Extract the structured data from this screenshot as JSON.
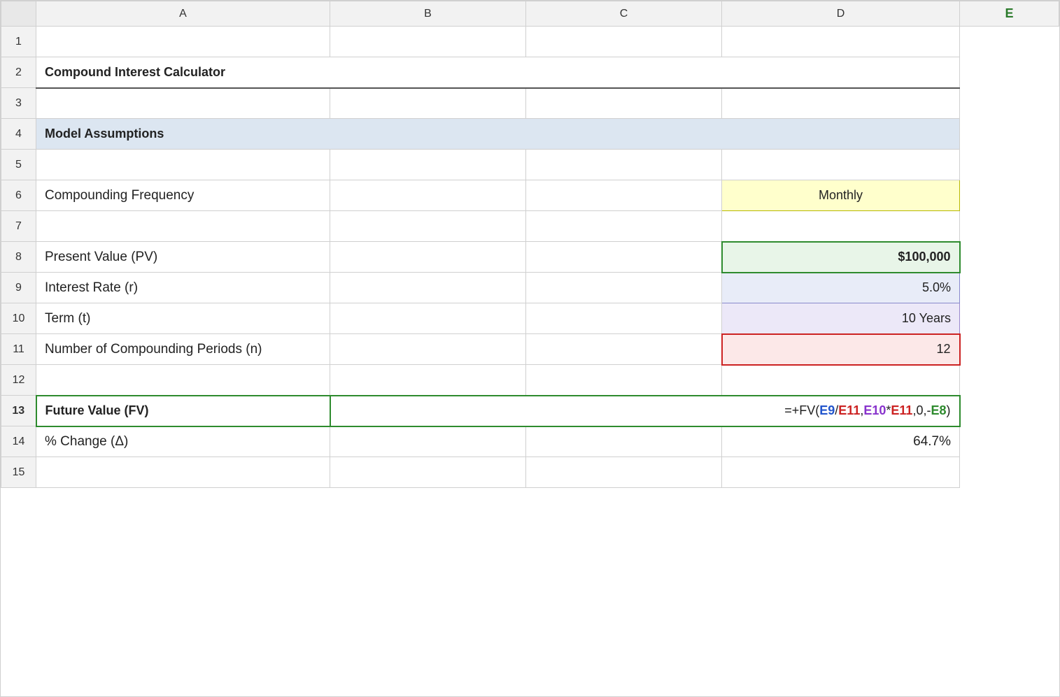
{
  "spreadsheet": {
    "title": "Compound Interest Calculator",
    "columns": {
      "corner": "",
      "A": "A",
      "B": "B",
      "C": "C",
      "D": "D",
      "E": "E"
    },
    "rows": {
      "row1": {
        "num": "1",
        "b": "",
        "c": "",
        "d": "",
        "e": ""
      },
      "row2": {
        "num": "2",
        "b": "Compound Interest Calculator",
        "c": "",
        "d": "",
        "e": ""
      },
      "row3": {
        "num": "3",
        "b": "",
        "c": "",
        "d": "",
        "e": ""
      },
      "row4": {
        "num": "4",
        "b": "Model Assumptions",
        "c": "",
        "d": "",
        "e": ""
      },
      "row5": {
        "num": "5",
        "b": "",
        "c": "",
        "d": "",
        "e": ""
      },
      "row6": {
        "num": "6",
        "b": "Compounding Frequency",
        "c": "",
        "d": "",
        "e": "Monthly"
      },
      "row7": {
        "num": "7",
        "b": "",
        "c": "",
        "d": "",
        "e": ""
      },
      "row8": {
        "num": "8",
        "b": "Present Value (PV)",
        "c": "",
        "d": "",
        "e": "$100,000"
      },
      "row9": {
        "num": "9",
        "b": "Interest Rate (r)",
        "c": "",
        "d": "",
        "e": "5.0%"
      },
      "row10": {
        "num": "10",
        "b": "Term (t)",
        "c": "",
        "d": "",
        "e": "10 Years"
      },
      "row11": {
        "num": "11",
        "b": "Number of Compounding Periods (n)",
        "c": "",
        "d": "",
        "e": "12"
      },
      "row12": {
        "num": "12",
        "b": "",
        "c": "",
        "d": "",
        "e": ""
      },
      "row13": {
        "num": "13",
        "b": "Future Value (FV)",
        "c": "",
        "d": "",
        "e_formula": "=+FV(E9/E11,E10*E11,0,-E8)"
      },
      "row14": {
        "num": "14",
        "b": "% Change (Δ)",
        "c": "",
        "d": "",
        "e": "64.7%"
      },
      "row15": {
        "num": "15",
        "b": "",
        "c": "",
        "d": "",
        "e": ""
      }
    }
  }
}
